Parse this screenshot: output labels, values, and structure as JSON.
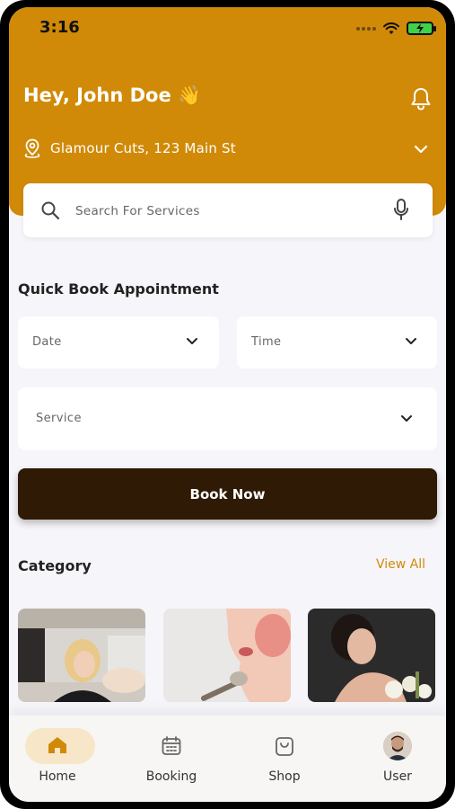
{
  "status_bar": {
    "time": "3:16"
  },
  "header": {
    "greeting": "Hey, John Doe 👋",
    "location": "Glamour Cuts, 123 Main St"
  },
  "search": {
    "placeholder": "Search For Services"
  },
  "quick_book": {
    "title": "Quick Book Appointment",
    "date_label": "Date",
    "time_label": "Time",
    "service_label": "Service",
    "book_button": "Book Now"
  },
  "category": {
    "title": "Category",
    "view_all": "View All"
  },
  "bottom_nav": {
    "items": [
      {
        "label": "Home",
        "icon": "home-icon",
        "active": true
      },
      {
        "label": "Booking",
        "icon": "calendar-icon",
        "active": false
      },
      {
        "label": "Shop",
        "icon": "shopping-bag-icon",
        "active": false
      },
      {
        "label": "User",
        "icon": "user-avatar",
        "active": false
      }
    ]
  },
  "colors": {
    "primary": "#d08a08",
    "dark_button": "#2f1a05",
    "background": "#f6f5fa"
  }
}
